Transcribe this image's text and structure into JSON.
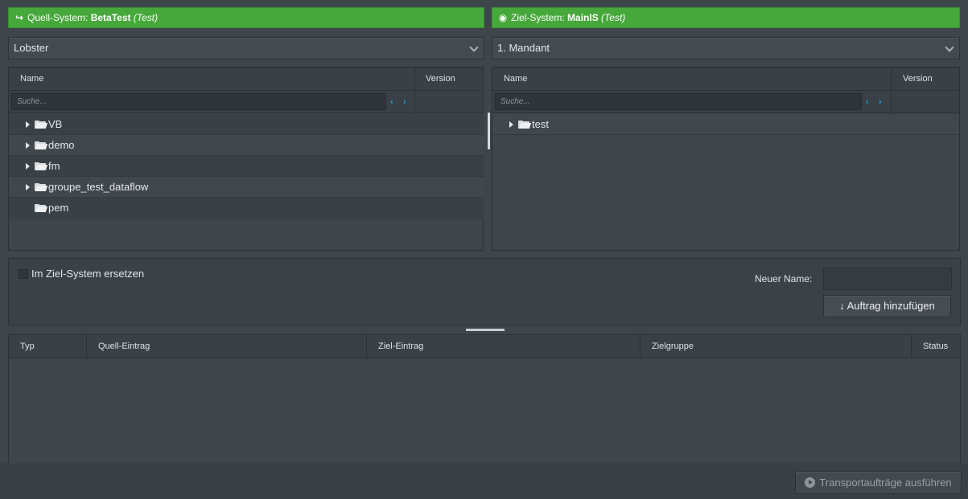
{
  "source": {
    "label": "Quell-System:",
    "system_name": "BetaTest",
    "env": "(Test)",
    "icon": "sign-in-icon",
    "dropdown_value": "Lobster",
    "columns": {
      "name": "Name",
      "version": "Version"
    },
    "search_placeholder": "Suche...",
    "items": [
      {
        "label": "VB",
        "expandable": true
      },
      {
        "label": "demo",
        "expandable": true
      },
      {
        "label": "fm",
        "expandable": true
      },
      {
        "label": "groupe_test_dataflow",
        "expandable": true
      },
      {
        "label": "pem",
        "expandable": false
      }
    ]
  },
  "target": {
    "label": "Ziel-System:",
    "system_name": "MainIS",
    "env": "(Test)",
    "icon": "dot-circle-icon",
    "dropdown_value": "1. Mandant",
    "columns": {
      "name": "Name",
      "version": "Version"
    },
    "search_placeholder": "Suche...",
    "items": [
      {
        "label": "test",
        "expandable": true
      }
    ]
  },
  "options": {
    "replace_label": "Im Ziel-System ersetzen",
    "replace_checked": false,
    "new_name_label": "Neuer Name:",
    "new_name_value": "",
    "add_button": "Auftrag hinzufügen"
  },
  "jobs_table": {
    "columns": [
      "Typ",
      "Quell-Eintrag",
      "Ziel-Eintrag",
      "Zielgruppe",
      "Status"
    ],
    "rows": []
  },
  "footer": {
    "execute_button": "Transportaufträge ausführen"
  },
  "colors": {
    "system_bar": "#46a83a",
    "accent_arrows": "#1aa0d8",
    "background": "#3e454b"
  }
}
